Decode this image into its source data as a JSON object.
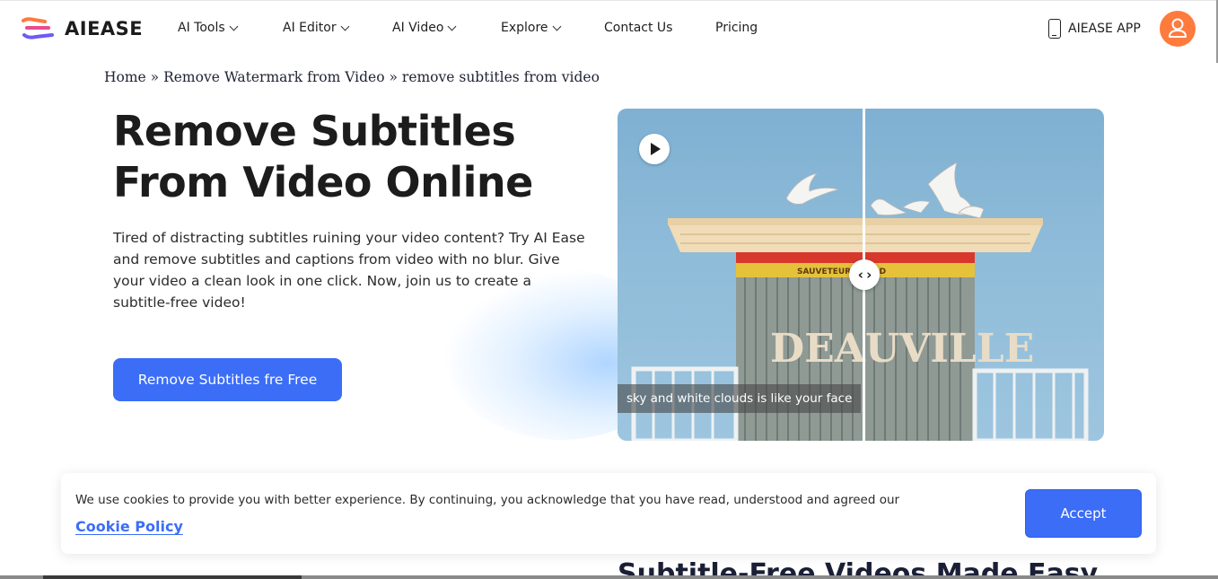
{
  "brand": {
    "name": "AIEASE",
    "accent": "#3b6df6",
    "avatar_color": "#ff7a3d"
  },
  "nav": {
    "items": [
      {
        "label": "AI Tools",
        "dropdown": true
      },
      {
        "label": "AI Editor",
        "dropdown": true
      },
      {
        "label": "AI Video",
        "dropdown": true
      },
      {
        "label": "Explore",
        "dropdown": true
      },
      {
        "label": "Contact Us",
        "dropdown": false
      },
      {
        "label": "Pricing",
        "dropdown": false
      }
    ],
    "app_label": "AIEASE APP",
    "app_icon": "phone-icon",
    "avatar_icon": "user-icon"
  },
  "breadcrumb": {
    "home": "Home",
    "sep1": "»",
    "parent": "Remove Watermark from Video",
    "sep2": "»",
    "current": "remove subtitles from video"
  },
  "hero": {
    "title_line1": "Remove Subtitles",
    "title_line2": "From Video Online",
    "description": "Tired of distracting subtitles ruining your video content? Try AI Ease and remove subtitles and captions from video with no blur. Give your video a clean look in one click. Now, join us to create a subtitle-free video!",
    "cta_label": "Remove Subtitles fre Free"
  },
  "media": {
    "play_icon": "play-icon",
    "compare_handle": "‹ ›",
    "compare_icon": "compare-arrows-icon",
    "sign_text_band": "SAUVETEUR  GUARD",
    "sign_big": "DEAUVILLE",
    "subtitle": "sky and white clouds is like your face"
  },
  "cookie": {
    "text": "We use cookies to provide you with better experience. By continuing, you acknowledge that you have read, understood and agreed our",
    "link": "Cookie Policy",
    "accept": "Accept"
  },
  "next_section": {
    "title": "Subtitle-Free Videos Made Easy"
  }
}
